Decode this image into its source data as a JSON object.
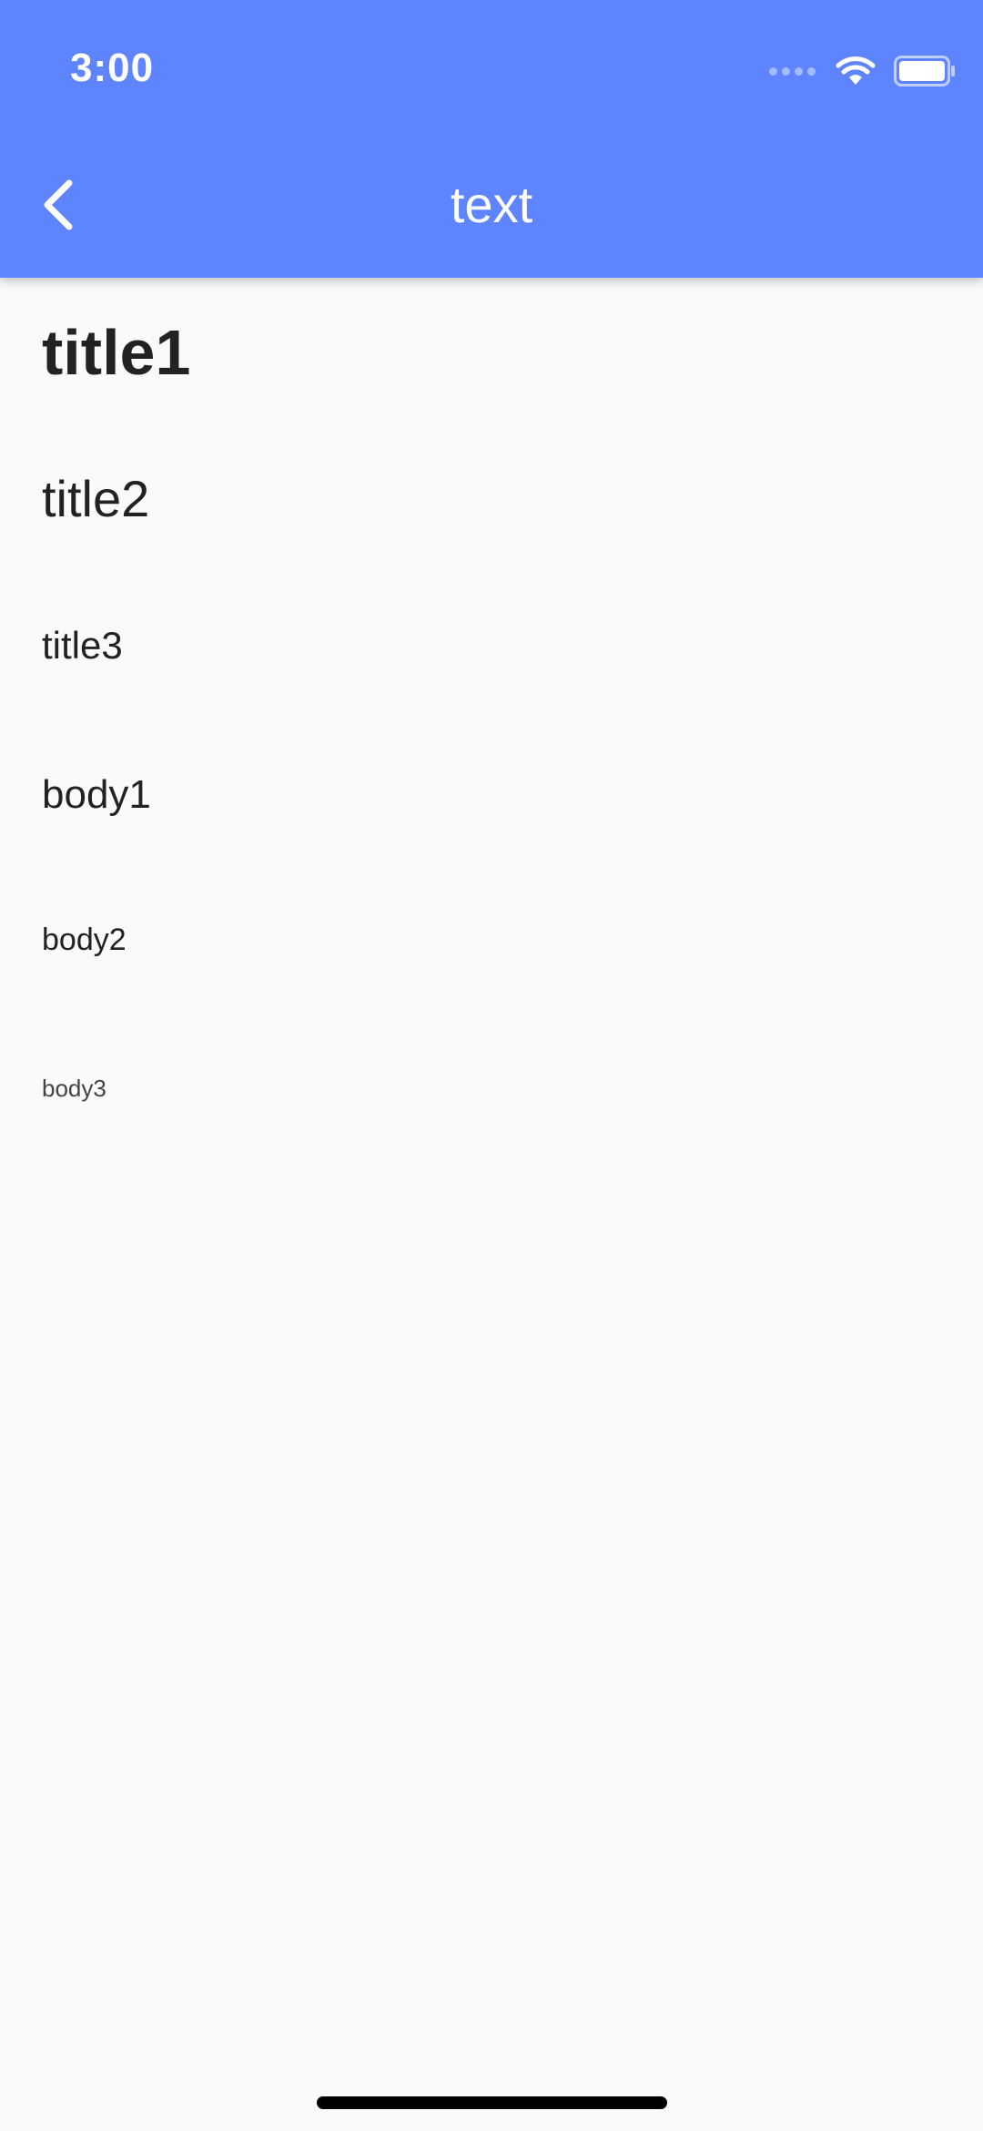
{
  "status_bar": {
    "time": "3:00"
  },
  "app_bar": {
    "title": "text",
    "back_icon": "chevron-left-icon",
    "background_color": "#5e84ff"
  },
  "content": {
    "items": [
      {
        "label": "title1"
      },
      {
        "label": "title2"
      },
      {
        "label": "title3"
      },
      {
        "label": "body1"
      },
      {
        "label": "body2"
      },
      {
        "label": "body3"
      }
    ]
  }
}
